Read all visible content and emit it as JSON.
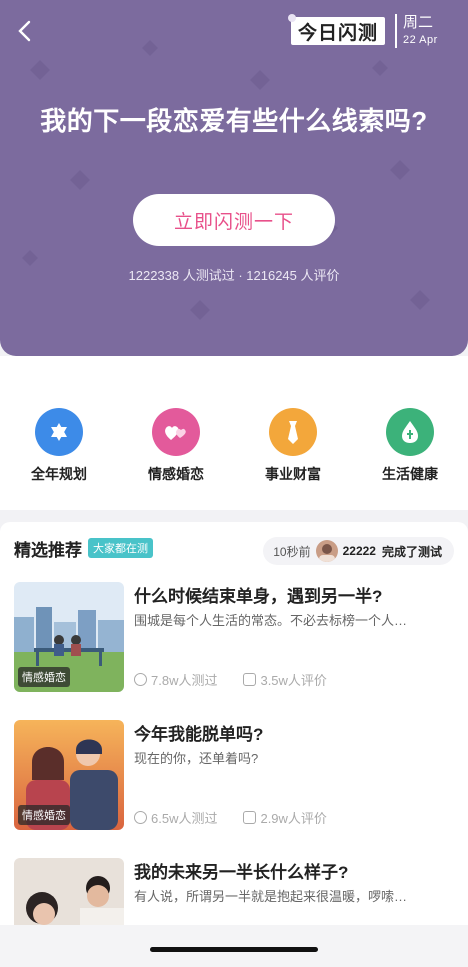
{
  "header": {
    "brand": "今日闪测",
    "weekday": "周二",
    "date": "22 Apr"
  },
  "hero": {
    "title": "我的下一段恋爱有些什么线索吗?",
    "cta_label": "立即闪测一下",
    "stats": "1222338 人测试过 · 1216245 人评价"
  },
  "categories": [
    {
      "label": "全年规划",
      "icon": "star-of-david-icon",
      "color": "#3d8be8"
    },
    {
      "label": "情感婚恋",
      "icon": "hearts-icon",
      "color": "#e35a9b"
    },
    {
      "label": "事业财富",
      "icon": "tie-icon",
      "color": "#f3a73b"
    },
    {
      "label": "生活健康",
      "icon": "leaf-drop-icon",
      "color": "#3cb27a"
    }
  ],
  "feed": {
    "title": "精选推荐",
    "badge": "大家都在测",
    "ticker": {
      "time": "10秒前",
      "user": "22222",
      "action": "完成了测试"
    }
  },
  "items": [
    {
      "title": "什么时候结束单身，遇到另一半?",
      "desc": "围城是每个人生活的常态。不必去标榜一个人…",
      "tag": "情感婚恋",
      "tested": "7.8w人测过",
      "reviews": "3.5w人评价"
    },
    {
      "title": "今年我能脱单吗?",
      "desc": "现在的你，还单着吗?",
      "tag": "情感婚恋",
      "tested": "6.5w人测过",
      "reviews": "2.9w人评价"
    },
    {
      "title": "我的未来另一半长什么样子?",
      "desc": "有人说，所谓另一半就是抱起来很温暖，啰嗦…",
      "tag": "",
      "tested": "",
      "reviews": ""
    }
  ],
  "colors": {
    "hero_bg": "#7c6b9e",
    "accent": "#e8508a",
    "badge": "#49c3c9"
  }
}
